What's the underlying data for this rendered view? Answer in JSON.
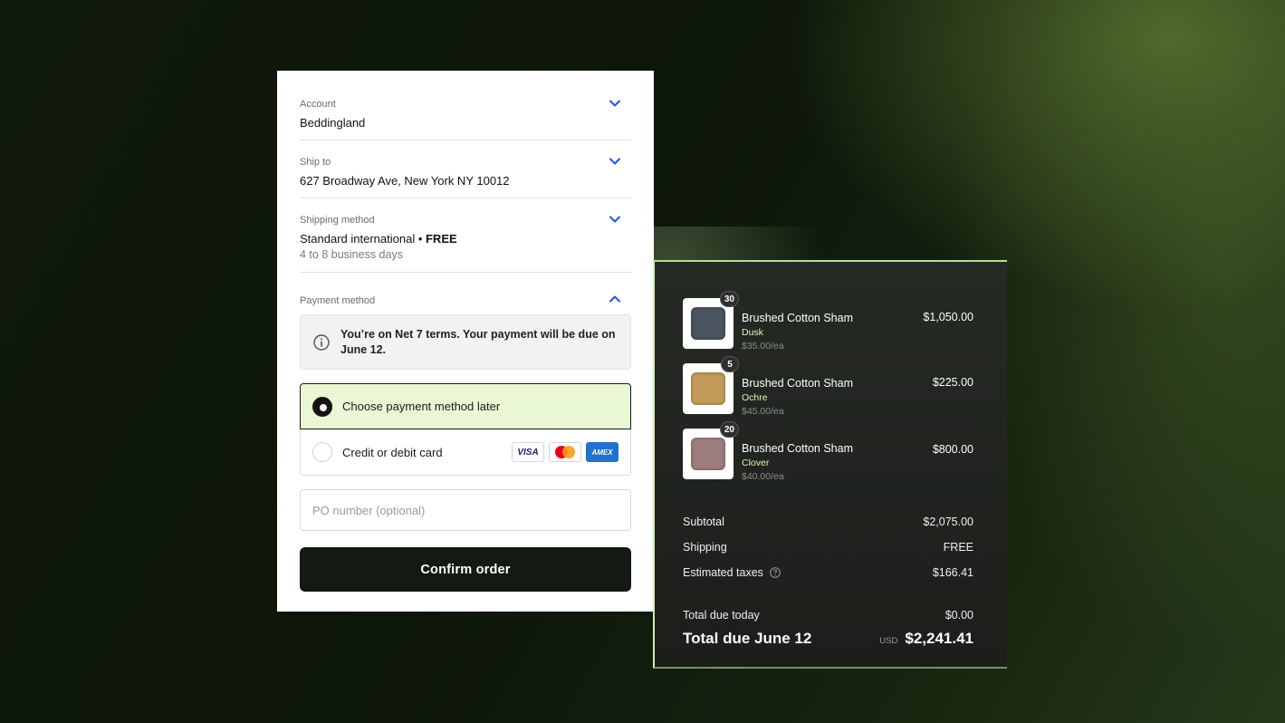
{
  "checkout": {
    "account": {
      "label": "Account",
      "value": "Beddingland"
    },
    "ship_to": {
      "label": "Ship to",
      "value": "627 Broadway Ave, New York NY 10012"
    },
    "shipping_method": {
      "label": "Shipping method",
      "value": "Standard international",
      "separator": " • ",
      "price": "FREE",
      "sub": "4 to 8 business days"
    },
    "payment": {
      "label": "Payment method",
      "notice": "You’re on Net 7 terms. Your payment will be due on June 12.",
      "options": [
        {
          "label": "Choose payment method later",
          "selected": true
        },
        {
          "label": "Credit or debit card",
          "selected": false
        }
      ],
      "cards": [
        "VISA",
        "Mastercard",
        "AMEX"
      ]
    },
    "po_placeholder": "PO number (optional)",
    "confirm_label": "Confirm order",
    "accent_color": "#2255e0"
  },
  "summary": {
    "items": [
      {
        "qty": "30",
        "name": "Brushed Cotton Sham",
        "variant": "Dusk",
        "unit": "$35.00/ea",
        "price": "$1,050.00",
        "color": "#4a5560"
      },
      {
        "qty": "5",
        "name": "Brushed Cotton Sham",
        "variant": "Ochre",
        "unit": "$45.00/ea",
        "price": "$225.00",
        "color": "#c39a5a"
      },
      {
        "qty": "20",
        "name": "Brushed Cotton Sham",
        "variant": "Clover",
        "unit": "$40.00/ea",
        "price": "$800.00",
        "color": "#9d7e7f"
      }
    ],
    "subtotal": {
      "label": "Subtotal",
      "value": "$2,075.00"
    },
    "shipping": {
      "label": "Shipping",
      "value": "FREE"
    },
    "taxes": {
      "label": "Estimated taxes",
      "value": "$166.41"
    },
    "due_today": {
      "label": "Total due today",
      "value": "$0.00"
    },
    "due_final": {
      "label": "Total due June 12",
      "currency": "USD",
      "value": "$2,241.41"
    }
  }
}
